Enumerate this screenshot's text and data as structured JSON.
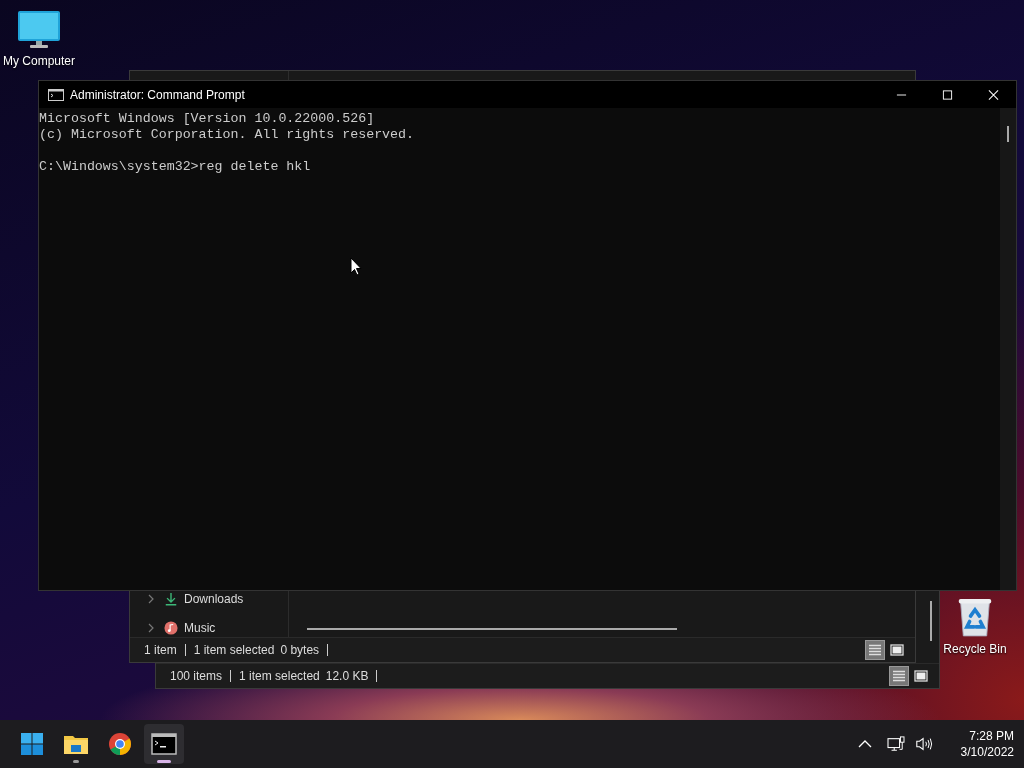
{
  "desktop_icons": [
    {
      "kind": "computer",
      "label": "My Computer"
    },
    {
      "kind": "recycle-bin",
      "label": "Recycle Bin"
    }
  ],
  "explorer_back": {
    "status": {
      "count": "100 items",
      "selection": "1 item selected",
      "size": "12.0 KB"
    },
    "view_buttons": [
      {
        "kind": "details",
        "selected": true
      },
      {
        "kind": "preview",
        "selected": false
      }
    ]
  },
  "explorer_front": {
    "nav_items": [
      {
        "kind": "downloads",
        "label": "Downloads"
      },
      {
        "kind": "music",
        "label": "Music"
      }
    ],
    "status": {
      "count": "1 item",
      "selection": "1 item selected",
      "size": "0 bytes"
    },
    "view_buttons": [
      {
        "kind": "details",
        "selected": true
      },
      {
        "kind": "preview",
        "selected": false
      }
    ]
  },
  "command_prompt": {
    "title": "Administrator: Command Prompt",
    "output": [
      "Microsoft Windows [Version 10.0.22000.526]",
      "(c) Microsoft Corporation. All rights reserved."
    ],
    "prompt": "C:\\Windows\\system32>reg delete hkl"
  },
  "taskbar": {
    "apps": [
      {
        "kind": "start",
        "running": false,
        "active": false
      },
      {
        "kind": "explorer",
        "running": true,
        "active": false
      },
      {
        "kind": "browser",
        "running": false,
        "active": false
      },
      {
        "kind": "terminal",
        "running": true,
        "active": true
      }
    ],
    "clock": {
      "time": "7:28 PM",
      "date": "3/10/2022"
    }
  }
}
